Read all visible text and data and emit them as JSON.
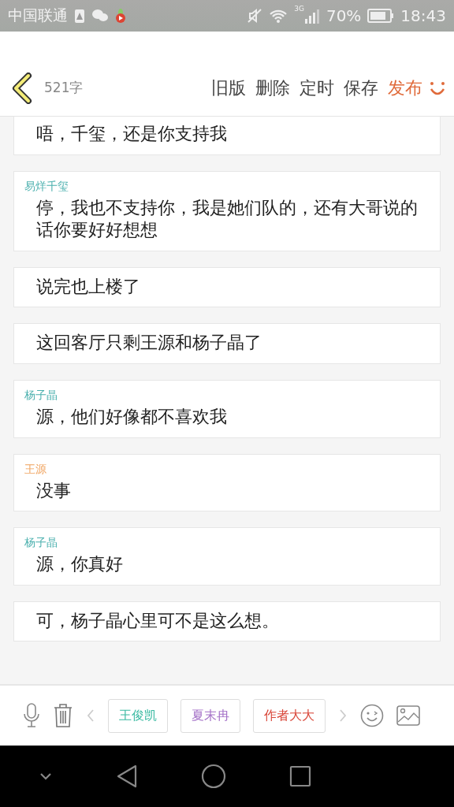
{
  "status_bar": {
    "carrier": "中国联通",
    "network": "3G",
    "battery": "70%",
    "time": "18:43"
  },
  "header": {
    "word_count": "521字",
    "actions": [
      {
        "label": "旧版",
        "kind": "plain"
      },
      {
        "label": "删除",
        "kind": "plain"
      },
      {
        "label": "定时",
        "kind": "plain"
      },
      {
        "label": "保存",
        "kind": "plain"
      },
      {
        "label": "发布",
        "kind": "primary"
      }
    ]
  },
  "messages": [
    {
      "text": "唔，千玺，还是你支持我"
    },
    {
      "speaker": "易烊千玺",
      "color": "#4bb0ae",
      "text": "停，我也不支持你，我是她们队的，还有大哥说的话你要好好想想"
    },
    {
      "text": "说完也上楼了"
    },
    {
      "text": "这回客厅只剩王源和杨子晶了"
    },
    {
      "speaker": "杨子晶",
      "color": "#4bb0ae",
      "text": "源，他们好像都不喜欢我"
    },
    {
      "speaker": "王源",
      "color": "#f0a35e",
      "text": "没事"
    },
    {
      "speaker": "杨子晶",
      "color": "#4bb0ae",
      "text": "源，你真好"
    },
    {
      "text": "可，杨子晶心里可不是这么想。"
    }
  ],
  "character_tags": [
    {
      "label": "王俊凯",
      "color": "#3dbba3"
    },
    {
      "label": "夏末冉",
      "color": "#a572c8"
    },
    {
      "label": "作者大大",
      "color": "#d9473a"
    }
  ]
}
